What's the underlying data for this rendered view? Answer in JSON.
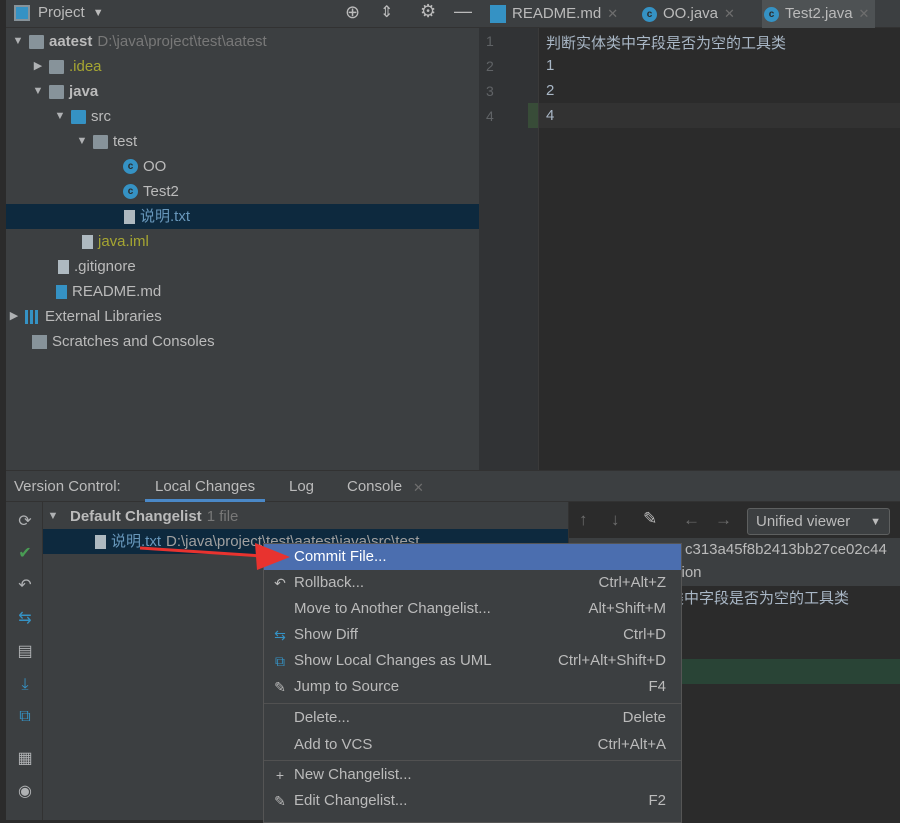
{
  "topbar": {
    "project_label": "Project",
    "tabs": [
      {
        "label": "README.md",
        "icon": "markdown-file-icon"
      },
      {
        "label": "OO.java",
        "icon": "java-class-icon"
      },
      {
        "label": "Test2.java",
        "icon": "java-class-run-icon"
      }
    ]
  },
  "tree": [
    {
      "label": "aatest",
      "path": "D:\\java\\project\\test\\aatest"
    },
    {
      "label": ".idea"
    },
    {
      "label": "java"
    },
    {
      "label": "src"
    },
    {
      "label": "test"
    },
    {
      "label": "OO"
    },
    {
      "label": "Test2"
    },
    {
      "label": "说明.txt"
    },
    {
      "label": "java.iml"
    },
    {
      "label": ".gitignore"
    },
    {
      "label": "README.md"
    },
    {
      "label": "External Libraries"
    },
    {
      "label": "Scratches and Consoles"
    }
  ],
  "editor": {
    "line_numbers": [
      "1",
      "2",
      "3",
      "4"
    ],
    "lines": [
      "判断实体类中字段是否为空的工具类",
      "1",
      "2",
      "4"
    ]
  },
  "vc": {
    "title": "Version Control:",
    "tabs": [
      "Local Changes",
      "Log",
      "Console"
    ],
    "active_tab": "Local Changes",
    "changelist": {
      "name": "Default Changelist",
      "count": "1 file",
      "file": "说明.txt",
      "file_path": "D:\\java\\project\\test\\aatest\\java\\src\\test"
    }
  },
  "diff": {
    "viewer": "Unified viewer",
    "revision": "c313a45f8b2413bb27ce02c44",
    "version_label": "rsion",
    "line": "类中字段是否为空的工具类"
  },
  "menu": [
    {
      "label": "Commit File...",
      "shortcut": ""
    },
    {
      "label": "Rollback...",
      "shortcut": "Ctrl+Alt+Z"
    },
    {
      "label": "Move to Another Changelist...",
      "shortcut": "Alt+Shift+M"
    },
    {
      "label": "Show Diff",
      "shortcut": "Ctrl+D"
    },
    {
      "label": "Show Local Changes as UML",
      "shortcut": "Ctrl+Alt+Shift+D"
    },
    {
      "label": "Jump to Source",
      "shortcut": "F4"
    },
    {
      "label": "Delete...",
      "shortcut": "Delete"
    },
    {
      "label": "Add to VCS",
      "shortcut": "Ctrl+Alt+A"
    },
    {
      "label": "New Changelist...",
      "shortcut": ""
    },
    {
      "label": "Edit Changelist...",
      "shortcut": "F2"
    }
  ],
  "colors": {
    "selection": "#4b6eaf",
    "accent": "#4a88c7",
    "arrow": "#e8332f",
    "added_line": "#294436"
  }
}
